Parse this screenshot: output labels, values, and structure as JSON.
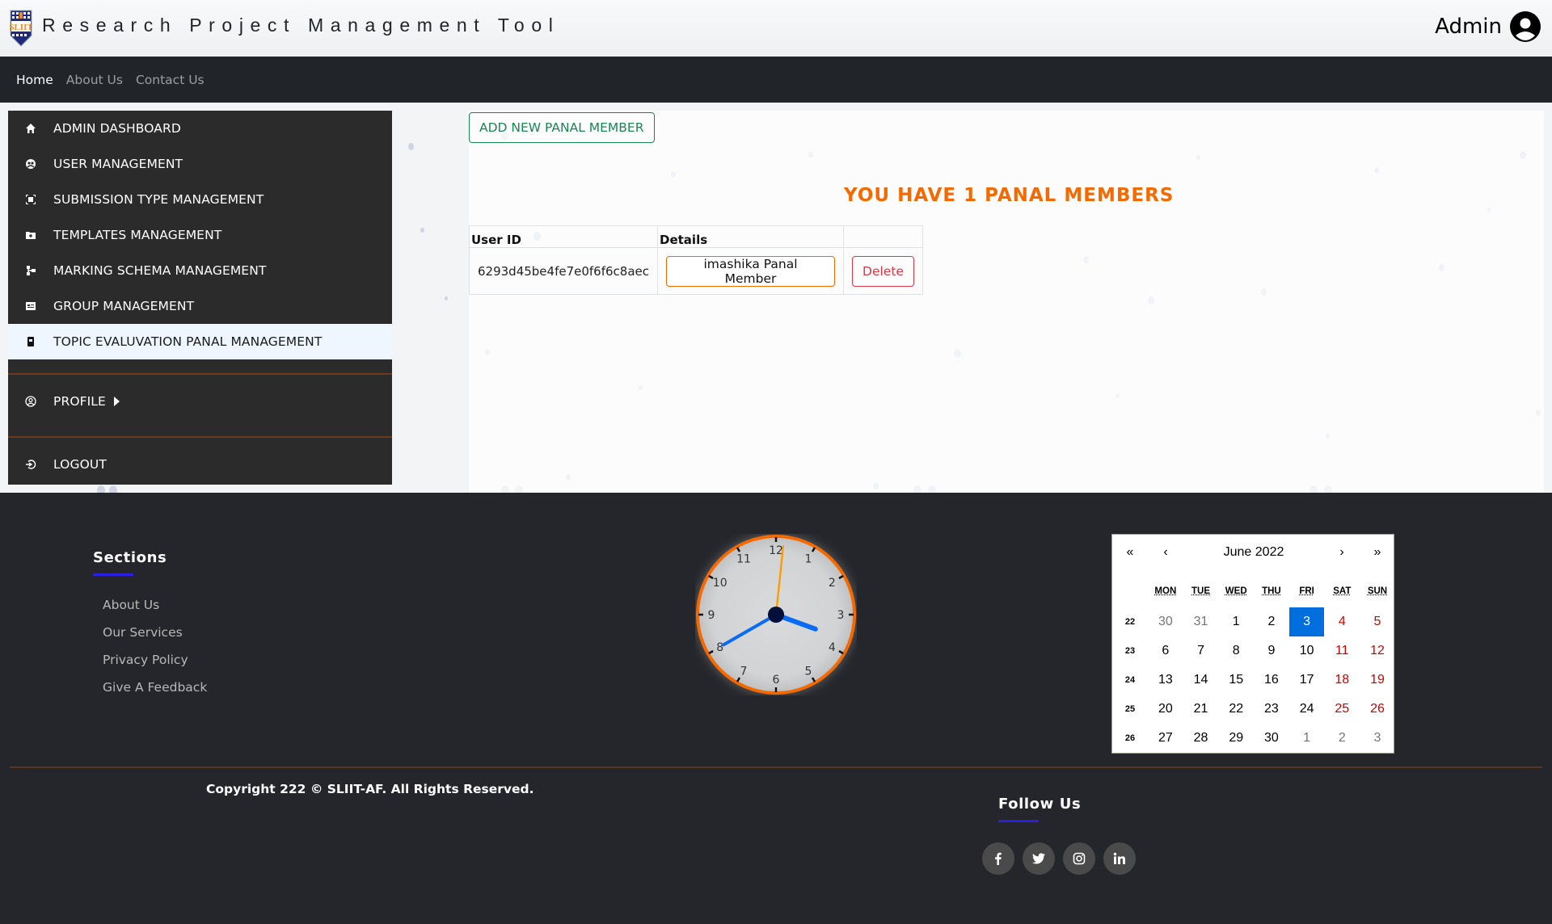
{
  "header": {
    "title": "Research Project Management Tool",
    "user_label": "Admin"
  },
  "nav": {
    "items": [
      {
        "label": "Home",
        "active": true
      },
      {
        "label": "About Us"
      },
      {
        "label": "Contact Us"
      }
    ]
  },
  "sidebar": {
    "items": [
      {
        "label": "ADMIN DASHBOARD",
        "icon": "home-icon"
      },
      {
        "label": "USER MANAGEMENT",
        "icon": "users-icon"
      },
      {
        "label": "SUBMISSION TYPE MANAGEMENT",
        "icon": "frame-icon"
      },
      {
        "label": "TEMPLATES MANAGEMENT",
        "icon": "folder-plus-icon"
      },
      {
        "label": "MARKING SCHEMA MANAGEMENT",
        "icon": "schema-icon"
      },
      {
        "label": "GROUP MANAGEMENT",
        "icon": "id-card-icon"
      },
      {
        "label": "TOPIC EVALUVATION PANAL MANAGEMENT",
        "icon": "badge-icon",
        "active": true
      }
    ],
    "profile_label": "PROFILE",
    "logout_label": "LOGOUT"
  },
  "main": {
    "add_button_label": "ADD NEW PANAL MEMBER",
    "count_title": "YOU HAVE 1 PANAL MEMBERS",
    "table": {
      "headers": [
        "User ID",
        "Details",
        ""
      ],
      "rows": [
        {
          "user_id": "6293d45be4fe7e0f6f6c8aec",
          "details_label": "imashika Panal Member",
          "action_label": "Delete"
        }
      ]
    }
  },
  "footer": {
    "sections_title": "Sections",
    "links": [
      "About Us",
      "Our Services",
      "Privacy Policy",
      "Give A Feedback"
    ],
    "clock": {
      "hour": 3,
      "minute": 40,
      "second": 1,
      "numbers": [
        "12",
        "1",
        "2",
        "3",
        "4",
        "5",
        "6",
        "7",
        "8",
        "9",
        "10",
        "11"
      ]
    },
    "calendar": {
      "month_label": "June 2022",
      "nav": {
        "prev_year": "«",
        "prev": "‹",
        "next": "›",
        "next_year": "»"
      },
      "weekdays": [
        "MON",
        "TUE",
        "WED",
        "THU",
        "FRI",
        "SAT",
        "SUN"
      ],
      "weeks": [
        {
          "week": "22",
          "days": [
            "30",
            "31",
            "1",
            "2",
            "3",
            "4",
            "5"
          ]
        },
        {
          "week": "23",
          "days": [
            "6",
            "7",
            "8",
            "9",
            "10",
            "11",
            "12"
          ]
        },
        {
          "week": "24",
          "days": [
            "13",
            "14",
            "15",
            "16",
            "17",
            "18",
            "19"
          ]
        },
        {
          "week": "25",
          "days": [
            "20",
            "21",
            "22",
            "23",
            "24",
            "25",
            "26"
          ]
        },
        {
          "week": "26",
          "days": [
            "27",
            "28",
            "29",
            "30",
            "1",
            "2",
            "3"
          ]
        }
      ],
      "selected": "3"
    },
    "copyright": "Copyright 222 © SLIIT-AF. All Rights Reserved.",
    "follow_title": "Follow Us",
    "social": [
      "facebook",
      "twitter",
      "instagram",
      "linkedin"
    ],
    "colors": {
      "accent": "#f56a00",
      "underline": "#2a1ee0",
      "today": "#006edc"
    }
  }
}
